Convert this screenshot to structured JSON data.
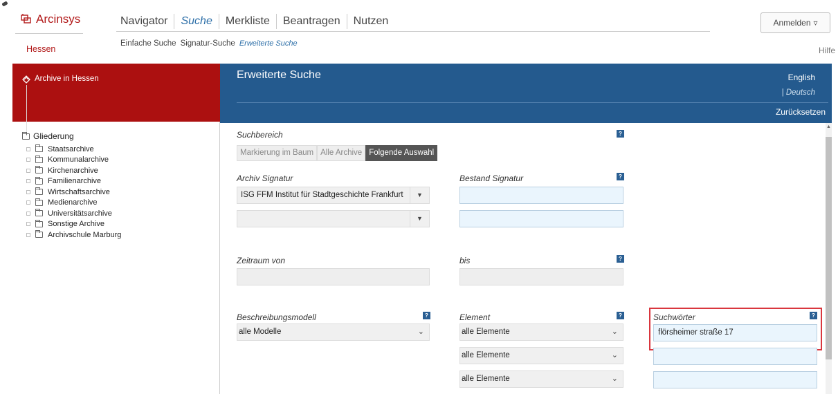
{
  "header": {
    "logo_text": "Arcinsys",
    "region": "Hessen",
    "nav": [
      {
        "label": "Navigator"
      },
      {
        "label": "Suche"
      },
      {
        "label": "Merkliste"
      },
      {
        "label": "Beantragen"
      },
      {
        "label": "Nutzen"
      }
    ],
    "sub_nav": [
      {
        "label": "Einfache Suche"
      },
      {
        "label": "Signatur-Suche"
      },
      {
        "label": "Erweiterte Suche"
      }
    ],
    "login_label": "Anmelden",
    "login_arrow": "▿",
    "help_label": "Hilfe"
  },
  "sidebar": {
    "title": "Archive in Hessen",
    "tree_root": "Gliederung",
    "items": [
      {
        "label": "Staatsarchive"
      },
      {
        "label": "Kommunalarchive"
      },
      {
        "label": "Kirchenarchive"
      },
      {
        "label": "Familienarchive"
      },
      {
        "label": "Wirtschaftsarchive"
      },
      {
        "label": "Medienarchive"
      },
      {
        "label": "Universitätsarchive"
      },
      {
        "label": "Sonstige Archive"
      },
      {
        "label": "Archivschule Marburg"
      }
    ]
  },
  "search": {
    "title": "Erweiterte Suche",
    "lang_english": "English",
    "lang_deutsch": "Deutsch",
    "lang_separator": "|",
    "reset_label": "Zurücksetzen",
    "help_glyph": "?",
    "scope": {
      "label": "Suchbereich",
      "options": [
        "Markierung im Baum",
        "Alle Archive",
        "Folgende Auswahl"
      ],
      "selected": "Folgende Auswahl"
    },
    "archive_signature": {
      "label": "Archiv Signatur",
      "value": "ISG FFM Institut für Stadtgeschichte Frankfurt",
      "second_value": ""
    },
    "holding_signature": {
      "label": "Bestand Signatur",
      "value": ""
    },
    "period_from": {
      "label": "Zeitraum von",
      "value": ""
    },
    "period_to": {
      "label": "bis",
      "value": ""
    },
    "description_model": {
      "label": "Beschreibungsmodell",
      "value": "alle Modelle"
    },
    "element": {
      "label": "Element",
      "values": [
        "alle Elemente",
        "alle Elemente",
        "alle Elemente"
      ]
    },
    "search_words": {
      "label": "Suchwörter",
      "values": [
        "flörsheimer straße 17",
        "",
        ""
      ]
    }
  },
  "colors": {
    "brand_red": "#ac1010",
    "header_blue": "#245a8e",
    "highlight": "#d9363e"
  },
  "icons": [
    "archive-logo-icon",
    "archive-icon",
    "folder-icon",
    "help-icon",
    "dropdown-arrow-icon",
    "chevron-down-icon"
  ]
}
